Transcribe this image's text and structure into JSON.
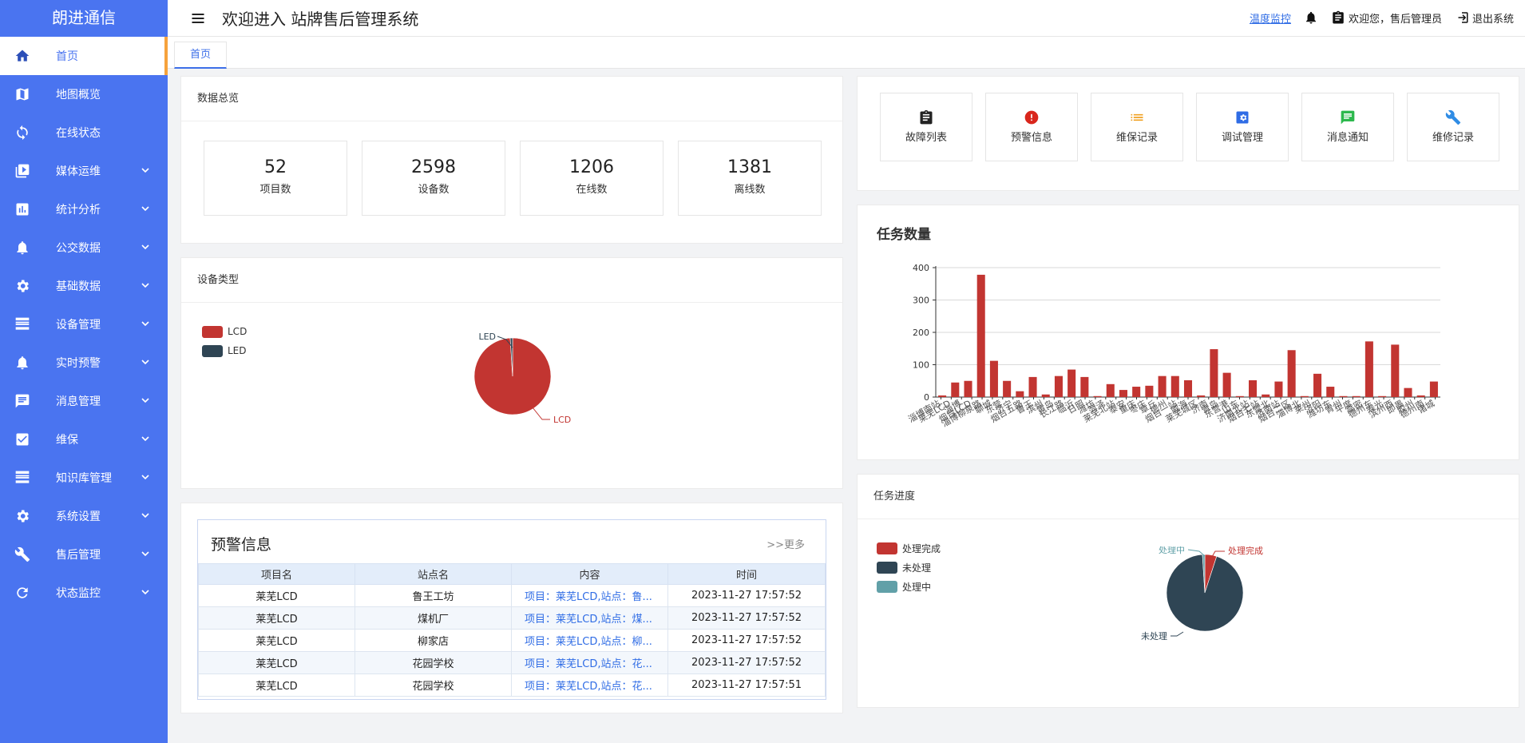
{
  "brand": "朗进通信",
  "header": {
    "title": "欢迎进入 站牌售后管理系统",
    "temp_link": "温度监控",
    "welcome": "欢迎您，售后管理员",
    "logout": "退出系统"
  },
  "tabs": [
    {
      "label": "首页"
    }
  ],
  "sidebar": {
    "items": [
      {
        "label": "首页",
        "icon": "home-icon",
        "active": true,
        "expandable": false
      },
      {
        "label": "地图概览",
        "icon": "map-icon",
        "expandable": false
      },
      {
        "label": "在线状态",
        "icon": "sync-icon",
        "expandable": false
      },
      {
        "label": "媒体运维",
        "icon": "media-icon",
        "expandable": true
      },
      {
        "label": "统计分析",
        "icon": "bar-chart-icon",
        "expandable": true
      },
      {
        "label": "公交数据",
        "icon": "bell-icon",
        "expandable": true
      },
      {
        "label": "基础数据",
        "icon": "gear-icon",
        "expandable": true
      },
      {
        "label": "设备管理",
        "icon": "storage-icon",
        "expandable": true
      },
      {
        "label": "实时预警",
        "icon": "bell-icon",
        "expandable": true
      },
      {
        "label": "消息管理",
        "icon": "message-icon",
        "expandable": true
      },
      {
        "label": "维保",
        "icon": "check-shield-icon",
        "expandable": true
      },
      {
        "label": "知识库管理",
        "icon": "storage-icon",
        "expandable": true
      },
      {
        "label": "系统设置",
        "icon": "gear-icon",
        "expandable": true
      },
      {
        "label": "售后管理",
        "icon": "wrench-icon",
        "expandable": true
      },
      {
        "label": "状态监控",
        "icon": "refresh-icon",
        "expandable": true
      }
    ]
  },
  "overview": {
    "title": "数据总览",
    "stats": [
      {
        "value": "52",
        "label": "项目数"
      },
      {
        "value": "2598",
        "label": "设备数"
      },
      {
        "value": "1206",
        "label": "在线数"
      },
      {
        "value": "1381",
        "label": "离线数"
      }
    ]
  },
  "device_type": {
    "title": "设备类型",
    "legend": [
      {
        "name": "LCD",
        "color": "#c23531"
      },
      {
        "name": "LED",
        "color": "#2f4554"
      }
    ]
  },
  "alerts": {
    "title": "预警信息",
    "more": ">>更多",
    "columns": [
      "项目名",
      "站点名",
      "内容",
      "时间"
    ],
    "rows": [
      [
        "莱芜LCD",
        "鲁王工坊",
        "项目：莱芜LCD,站点：鲁...",
        "2023-11-27 17:57:52"
      ],
      [
        "莱芜LCD",
        "煤机厂",
        "项目：莱芜LCD,站点：煤...",
        "2023-11-27 17:57:52"
      ],
      [
        "莱芜LCD",
        "柳家店",
        "项目：莱芜LCD,站点：柳...",
        "2023-11-27 17:57:52"
      ],
      [
        "莱芜LCD",
        "花园学校",
        "项目：莱芜LCD,站点：花...",
        "2023-11-27 17:57:52"
      ],
      [
        "莱芜LCD",
        "花园学校",
        "项目：莱芜LCD,站点：花...",
        "2023-11-27 17:57:51"
      ]
    ]
  },
  "quick_entries": [
    {
      "label": "故障列表",
      "icon": "clipboard-icon",
      "color": "#222222"
    },
    {
      "label": "预警信息",
      "icon": "alert-circle-icon",
      "color": "#d9261c"
    },
    {
      "label": "维保记录",
      "icon": "list-icon",
      "color": "#f0a020"
    },
    {
      "label": "调试管理",
      "icon": "settings-box-icon",
      "color": "#2f6ce5"
    },
    {
      "label": "消息通知",
      "icon": "message-icon",
      "color": "#2db84d"
    },
    {
      "label": "维修记录",
      "icon": "wrench-icon",
      "color": "#2f8ce5"
    }
  ],
  "task_progress": {
    "title": "任务进度",
    "legend": [
      {
        "name": "处理完成",
        "color": "#c23531"
      },
      {
        "name": "未处理",
        "color": "#2f4554"
      },
      {
        "name": "处理中",
        "color": "#61a0a8"
      }
    ]
  },
  "chart_data": [
    {
      "type": "pie",
      "labels": [
        "LCD",
        "LED"
      ],
      "values": [
        99,
        1
      ],
      "colors": [
        "#c23531",
        "#2f4554"
      ]
    },
    {
      "type": "bar",
      "title": "任务数量",
      "ylim": [
        0,
        400
      ],
      "yticks": [
        0,
        100,
        200,
        300,
        400
      ],
      "grid": true,
      "color": "#c23531",
      "categories": [
        "淄博南站",
        "莱芜LCD",
        "淄博",
        "烟台LCD",
        "淄博柳泉路",
        "聊城",
        "东营",
        "济宁",
        "烟台五路",
        "鲁王",
        "滨州",
        "黄岛",
        "长江路",
        "临沂",
        "日照",
        "潍坊",
        "菏泽",
        "莱芜北站",
        "泰安",
        "重庆",
        "枣庄",
        "章丘",
        "德州",
        "烟台一站",
        "威海",
        "莱芜城区",
        "济南",
        "青岛",
        "东营港",
        "山东",
        "济南北站",
        "烟台七站",
        "东营北",
        "济南站",
        "烟台二区",
        "淄博北",
        "莱州",
        "济阳",
        "潍坊东",
        "青州",
        "平度",
        "高密",
        "德州东",
        "寿光",
        "滨州西",
        "即墨",
        "胶州",
        "德州南",
        "诸城"
      ],
      "values": [
        5,
        45,
        50,
        378,
        112,
        50,
        18,
        62,
        8,
        65,
        85,
        62,
        3,
        40,
        22,
        32,
        35,
        65,
        65,
        52,
        5,
        148,
        75,
        3,
        52,
        8,
        48,
        145,
        3,
        72,
        32,
        3,
        3,
        172,
        3,
        162,
        28,
        5,
        48
      ]
    },
    {
      "type": "pie",
      "labels": [
        "处理完成",
        "未处理",
        "处理中"
      ],
      "values": [
        5,
        94,
        1
      ],
      "colors": [
        "#c23531",
        "#2f4554",
        "#61a0a8"
      ]
    }
  ]
}
